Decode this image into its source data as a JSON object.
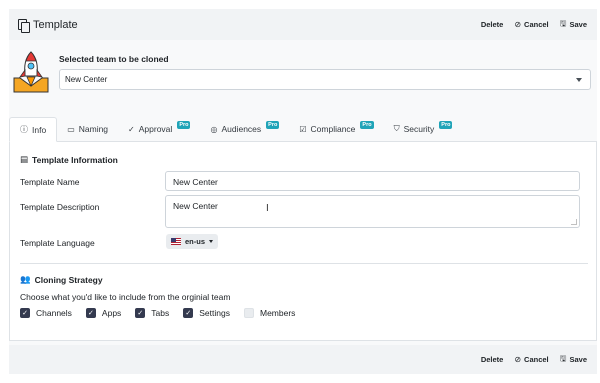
{
  "header": {
    "title": "Template",
    "delete_label": "Delete",
    "cancel_label": "Cancel",
    "save_label": "Save"
  },
  "clone": {
    "label": "Selected team to be cloned",
    "selected": "New Center"
  },
  "tabs": [
    {
      "label": "Info",
      "icon": "info-circle-icon",
      "pro": ""
    },
    {
      "label": "Naming",
      "icon": "id-card-icon",
      "pro": ""
    },
    {
      "label": "Approval",
      "icon": "check-circle-icon",
      "pro": "Pro"
    },
    {
      "label": "Audiences",
      "icon": "target-icon",
      "pro": "Pro"
    },
    {
      "label": "Compliance",
      "icon": "check-square-icon",
      "pro": "Pro"
    },
    {
      "label": "Security",
      "icon": "shield-icon",
      "pro": "Pro"
    }
  ],
  "template_info": {
    "heading": "Template Information",
    "name_label": "Template Name",
    "name_value": "New Center",
    "description_label": "Template Description",
    "description_value": "New Center",
    "language_label": "Template Language",
    "language_value": "en-us"
  },
  "cloning": {
    "heading": "Cloning Strategy",
    "description": "Choose what you'd like to include from the orginial team",
    "options": [
      {
        "label": "Channels",
        "checked": true
      },
      {
        "label": "Apps",
        "checked": true
      },
      {
        "label": "Tabs",
        "checked": true
      },
      {
        "label": "Settings",
        "checked": true
      },
      {
        "label": "Members",
        "checked": false
      }
    ]
  },
  "footer": {
    "delete_label": "Delete",
    "cancel_label": "Cancel",
    "save_label": "Save"
  },
  "colors": {
    "pro_badge": "#20a4b8",
    "checkbox": "#343a4f"
  }
}
